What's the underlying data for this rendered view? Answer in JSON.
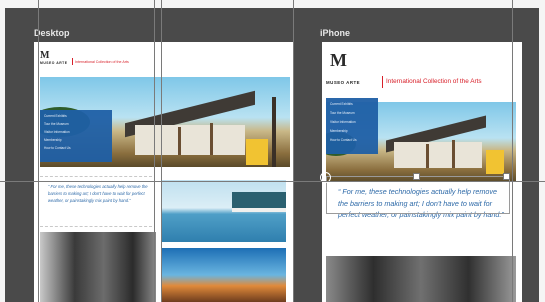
{
  "artboards": {
    "desktop_label": "Desktop",
    "iphone_label": "iPhone"
  },
  "site": {
    "logo_mark": "M",
    "logo_text": "MUSEO ARTE",
    "tagline": "International Collection of the Arts",
    "nav_items": [
      "Current Exhibits",
      "Tour the Museum",
      "Visitor Information",
      "Membership",
      "How to Contact Us"
    ],
    "quote": "“ For me, these technologies actually help remove the barriers to making art; I don't have to wait for perfect weather, or painstakingly mix paint by hand.”"
  },
  "colors": {
    "canvas": "#4a4a4a",
    "accent_red": "#d8202a",
    "nav_blue": "#1f5fa5",
    "quote_blue": "#2e6aa8"
  }
}
